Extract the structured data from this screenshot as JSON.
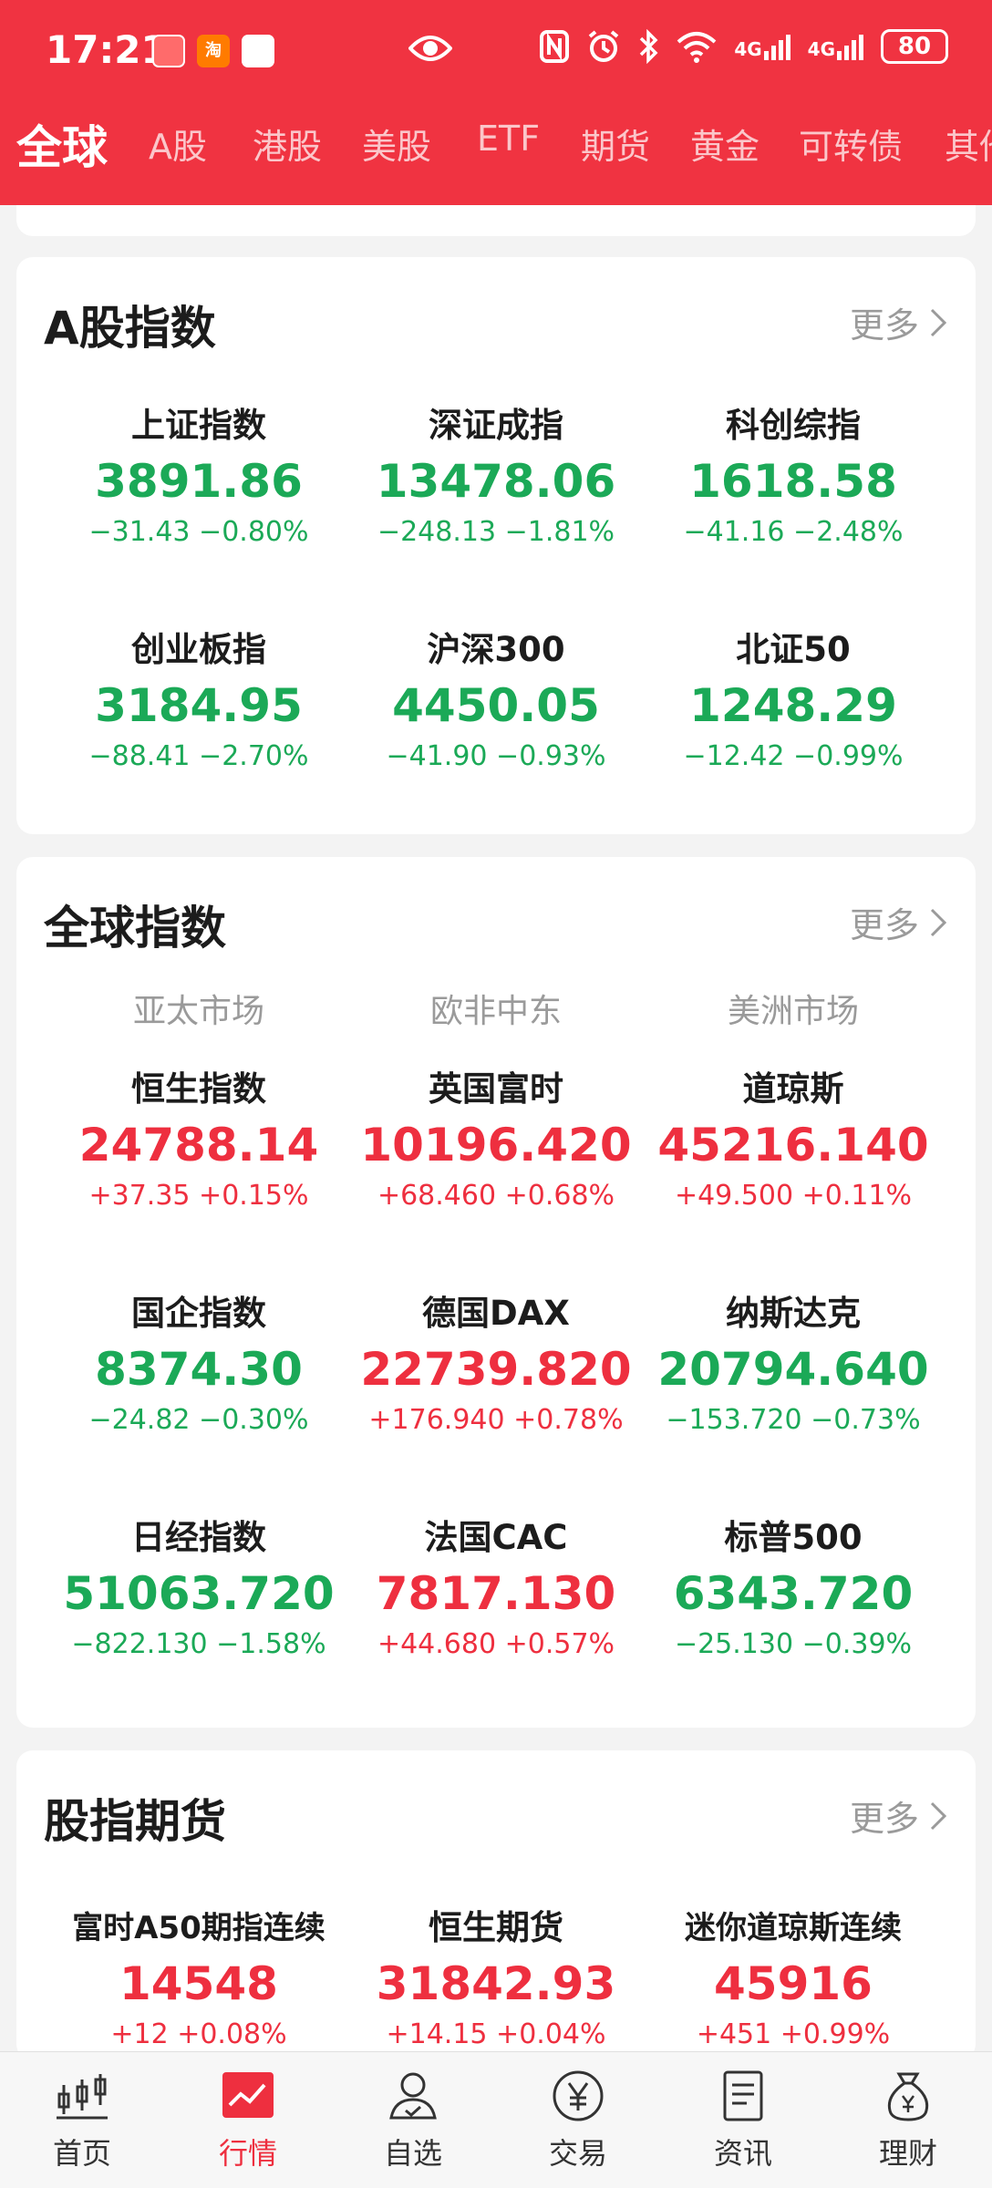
{
  "status_bar": {
    "time": "17:21",
    "battery": "80",
    "signal_a": "4G",
    "signal_b": "4G",
    "app_badge_2": "淘"
  },
  "tabs": [
    "全球",
    "A股",
    "港股",
    "美股",
    "ETF",
    "期货",
    "黄金",
    "可转债",
    "其他"
  ],
  "colors": {
    "brand": "#f03341",
    "up": "#ee2f3f",
    "down": "#1ba957"
  },
  "a_share": {
    "title": "A股指数",
    "more": "更多",
    "items": [
      {
        "name": "上证指数",
        "price": "3891.86",
        "change": "−31.43 −0.80%",
        "dir": "down"
      },
      {
        "name": "深证成指",
        "price": "13478.06",
        "change": "−248.13 −1.81%",
        "dir": "down"
      },
      {
        "name": "科创综指",
        "price": "1618.58",
        "change": "−41.16 −2.48%",
        "dir": "down"
      },
      {
        "name": "创业板指",
        "price": "3184.95",
        "change": "−88.41 −2.70%",
        "dir": "down"
      },
      {
        "name": "沪深300",
        "price": "4450.05",
        "change": "−41.90 −0.93%",
        "dir": "down"
      },
      {
        "name": "北证50",
        "price": "1248.29",
        "change": "−12.42 −0.99%",
        "dir": "down"
      }
    ]
  },
  "global": {
    "title": "全球指数",
    "more": "更多",
    "regions": [
      "亚太市场",
      "欧非中东",
      "美洲市场"
    ],
    "items": [
      {
        "name": "恒生指数",
        "price": "24788.14",
        "change": "+37.35 +0.15%",
        "dir": "up"
      },
      {
        "name": "英国富时",
        "price": "10196.420",
        "change": "+68.460 +0.68%",
        "dir": "up"
      },
      {
        "name": "道琼斯",
        "price": "45216.140",
        "change": "+49.500 +0.11%",
        "dir": "up"
      },
      {
        "name": "国企指数",
        "price": "8374.30",
        "change": "−24.82 −0.30%",
        "dir": "down"
      },
      {
        "name": "德国DAX",
        "price": "22739.820",
        "change": "+176.940 +0.78%",
        "dir": "up"
      },
      {
        "name": "纳斯达克",
        "price": "20794.640",
        "change": "−153.720 −0.73%",
        "dir": "down"
      },
      {
        "name": "日经指数",
        "price": "51063.720",
        "change": "−822.130 −1.58%",
        "dir": "down"
      },
      {
        "name": "法国CAC",
        "price": "7817.130",
        "change": "+44.680 +0.57%",
        "dir": "up"
      },
      {
        "name": "标普500",
        "price": "6343.720",
        "change": "−25.130 −0.39%",
        "dir": "down"
      }
    ]
  },
  "futures": {
    "title": "股指期货",
    "more": "更多",
    "items": [
      {
        "name": "富时A50期指连续",
        "price": "14548",
        "change": "+12 +0.08%",
        "dir": "up"
      },
      {
        "name": "恒生期货",
        "price": "31842.93",
        "change": "+14.15 +0.04%",
        "dir": "up"
      },
      {
        "name": "迷你道琼斯连续",
        "price": "45916",
        "change": "+451 +0.99%",
        "dir": "up"
      }
    ]
  },
  "bottom_nav": [
    {
      "label": "首页",
      "icon": "candlestick-icon",
      "active": false
    },
    {
      "label": "行情",
      "icon": "market-chart-icon",
      "active": true
    },
    {
      "label": "自选",
      "icon": "user-check-icon",
      "active": false
    },
    {
      "label": "交易",
      "icon": "yen-icon",
      "active": false
    },
    {
      "label": "资讯",
      "icon": "news-icon",
      "active": false
    },
    {
      "label": "理财",
      "icon": "money-bag-icon",
      "active": false
    }
  ]
}
